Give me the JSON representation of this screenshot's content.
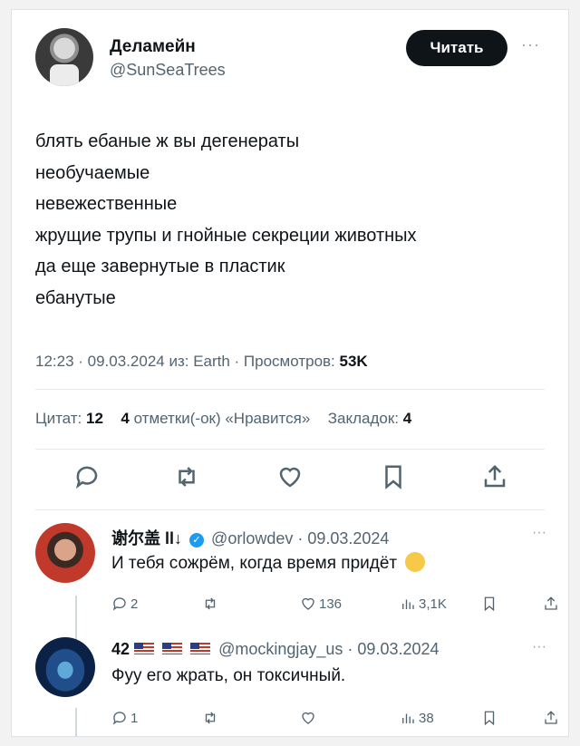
{
  "tweet": {
    "author_name": "Деламейн",
    "author_handle": "@SunSeaTrees",
    "follow_label": "Читать",
    "more_label": "···",
    "lines": [
      "блять ебаные ж вы дегенераты",
      "необучаемые",
      "невежественные",
      "жрущие трупы и гнойные секреции животных",
      "да еще завернутые в пластик",
      "ебанутые"
    ],
    "meta_prefix": "12:23 · 09.03.2024 из: Earth · Просмотров:",
    "views": "53K",
    "stats": {
      "quotes_label": "Цитат:",
      "quotes_count": "12",
      "reposts_count": "4",
      "reposts_label": "отметки(-ок) «Нравится»",
      "bookmarks_label": "Закладок:",
      "bookmarks_count": "4"
    },
    "actions": [
      "reply-icon",
      "repost-icon",
      "like-icon",
      "bookmark-icon",
      "share-icon"
    ]
  },
  "replies": [
    {
      "name": "谢尔盖 ll↓",
      "verified": true,
      "handle_date": "@orlowdev · 09.03.2024",
      "text": "И тебя сожрём, когда время придёт",
      "reply_count": "2",
      "repost_count": "",
      "like_count": "136",
      "views_count": "3,1K",
      "more_label": "···"
    },
    {
      "name": "42",
      "handle_date": "@mockingjay_us · 09.03.2024",
      "text": "Фуу его жрать, он токсичный.",
      "reply_count": "1",
      "repost_count": "",
      "like_count": "",
      "views_count": "38",
      "more_label": "···"
    }
  ],
  "colors": {
    "text": "#0f1419",
    "secondary": "#536471",
    "verified": "#1d9bf0",
    "button_bg": "#0f1419"
  }
}
